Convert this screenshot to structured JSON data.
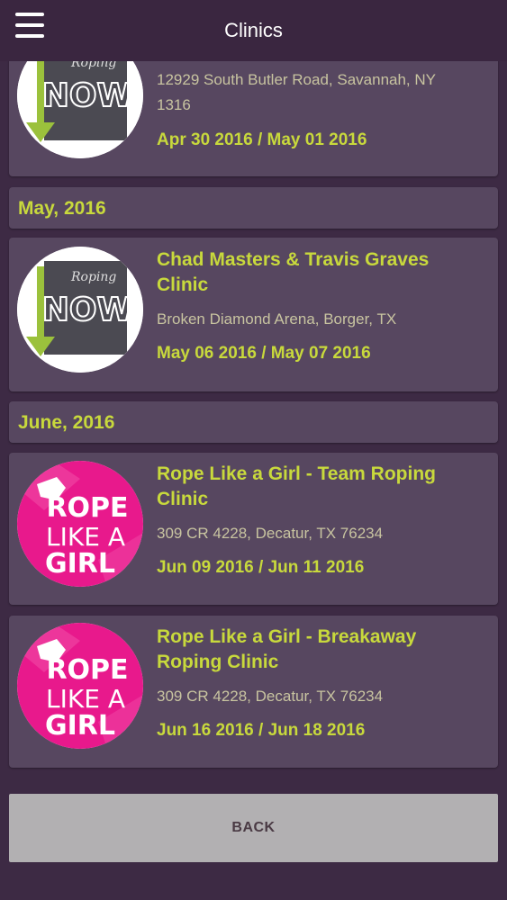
{
  "header": {
    "title": "Clinics",
    "menu_icon": "hamburger-menu-icon"
  },
  "months": {
    "may": "May, 2016",
    "june": "June, 2016"
  },
  "clinics": [
    {
      "title": "",
      "address_line1": "12929 South Butler Road, Savannah, NY",
      "address_line2": "1316",
      "dates": "Apr 30 2016 / May 01 2016",
      "logo": {
        "type": "roping-now",
        "script": "Roping",
        "word": "NOW"
      }
    },
    {
      "title_line1": "Chad Masters & Travis Graves",
      "title_line2": "Clinic",
      "address": "Broken Diamond Arena, Borger, TX",
      "dates": "May 06 2016 / May 07 2016",
      "logo": {
        "type": "roping-now",
        "script": "Roping",
        "word": "NOW"
      }
    },
    {
      "title_line1": "Rope Like a Girl - Team Roping",
      "title_line2": "Clinic",
      "address": "309 CR 4228, Decatur, TX 76234",
      "dates": "Jun 09 2016 / Jun 11 2016",
      "logo": {
        "type": "rope-like-a-girl",
        "line1": "ROPE",
        "line2": "LIKE A",
        "line3": "GIRL"
      }
    },
    {
      "title_line1": "Rope Like a Girl - Breakaway",
      "title_line2": "Roping Clinic",
      "address": "309 CR 4228, Decatur, TX 76234",
      "dates": "Jun 16 2016 / Jun 18 2016",
      "logo": {
        "type": "rope-like-a-girl",
        "line1": "ROPE",
        "line2": "LIKE A",
        "line3": "GIRL"
      }
    }
  ],
  "footer": {
    "back_label": "BACK"
  },
  "colors": {
    "background": "#3d2a44",
    "card": "#574760",
    "accent": "#c8d93c",
    "address_text": "#c8c4a0",
    "back_button": "#b2b0b2",
    "pink": "#e8198c"
  }
}
